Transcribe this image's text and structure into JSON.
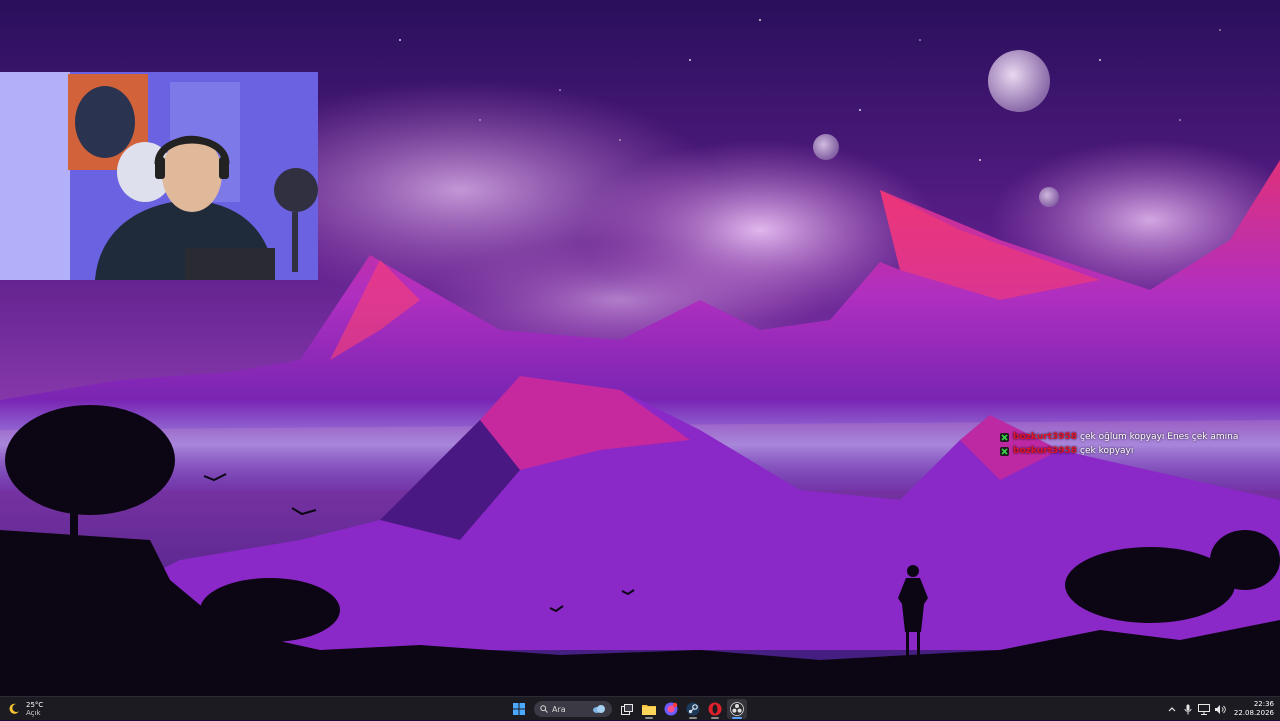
{
  "chat": {
    "messages": [
      {
        "user": "bozkurt3958",
        "text": "çek oğlum kopyayı Enes çek amına"
      },
      {
        "user": "bozkurt3958",
        "text": "çek kopyayı"
      }
    ]
  },
  "taskbar": {
    "weather": {
      "temperature": "25°C",
      "condition": "Açık",
      "icon": "weather-moon-icon"
    },
    "search": {
      "placeholder": "Ara"
    },
    "pinned_apps": [
      {
        "name": "start-menu",
        "icon": "windows-logo-icon"
      },
      {
        "name": "task-view",
        "icon": "task-view-icon"
      },
      {
        "name": "file-explorer",
        "icon": "folder-icon"
      },
      {
        "name": "chat-app",
        "icon": "chat-app-icon"
      },
      {
        "name": "steam",
        "icon": "steam-icon"
      },
      {
        "name": "opera-gx",
        "icon": "opera-icon"
      },
      {
        "name": "obs",
        "icon": "obs-icon"
      }
    ],
    "clock": {
      "time": "22:36",
      "date": "22.08.2026"
    },
    "accent_color": "#3b82f6"
  },
  "wallpaper": {
    "colors": {
      "sky_top": "#2a0f5c",
      "sky_mid": "#7a2e9e",
      "mountains": "#d02fa0",
      "mountains_shadow": "#5b1a8c",
      "ground": "#0c0614"
    }
  }
}
